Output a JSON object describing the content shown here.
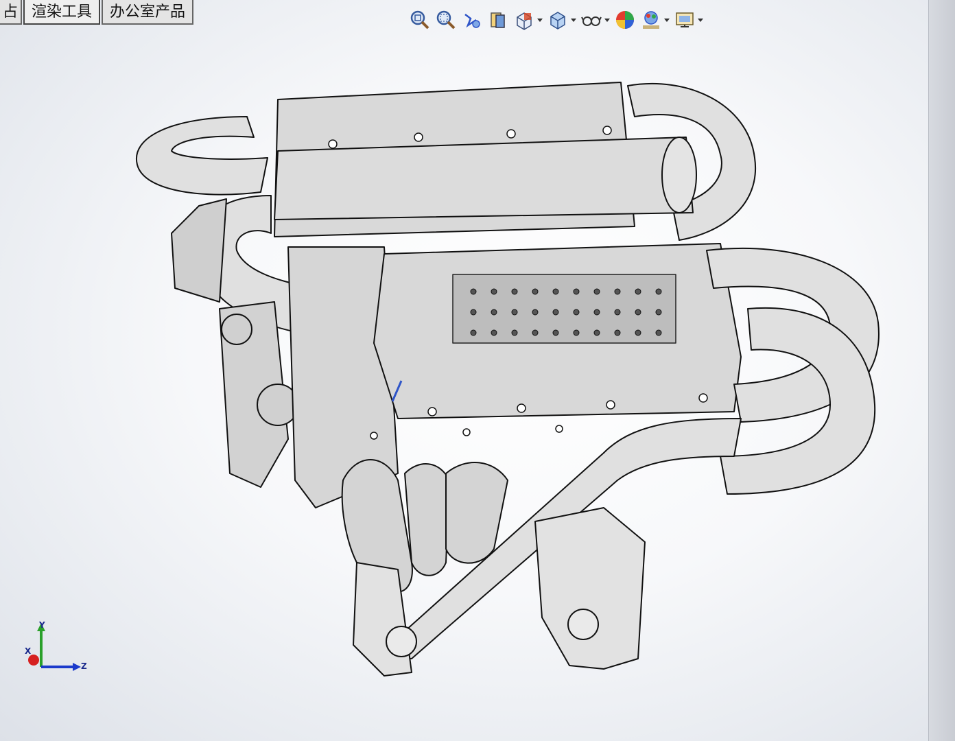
{
  "tabs": [
    {
      "label": "占",
      "active": false
    },
    {
      "label": "渲染工具",
      "active": true
    },
    {
      "label": "办公室产品",
      "active": false
    }
  ],
  "toolbar": [
    {
      "icon": "zoom-to-fit-icon"
    },
    {
      "icon": "zoom-to-area-icon"
    },
    {
      "icon": "previous-view-icon"
    },
    {
      "icon": "section-view-icon"
    },
    {
      "icon": "view-orientation-icon",
      "dropdown": true
    },
    {
      "icon": "display-style-icon",
      "dropdown": true
    },
    {
      "icon": "hide-show-items-icon",
      "dropdown": true
    },
    {
      "icon": "edit-appearance-icon"
    },
    {
      "icon": "apply-scene-icon",
      "dropdown": true
    },
    {
      "icon": "view-settings-icon",
      "dropdown": true
    }
  ],
  "triad": {
    "y": "Y",
    "x": "X",
    "z": "Z"
  },
  "colors": {
    "accent_blue": "#2f55c8",
    "triad_green": "#2aa02a",
    "triad_red": "#d62020",
    "triad_blue": "#1b3acb"
  }
}
